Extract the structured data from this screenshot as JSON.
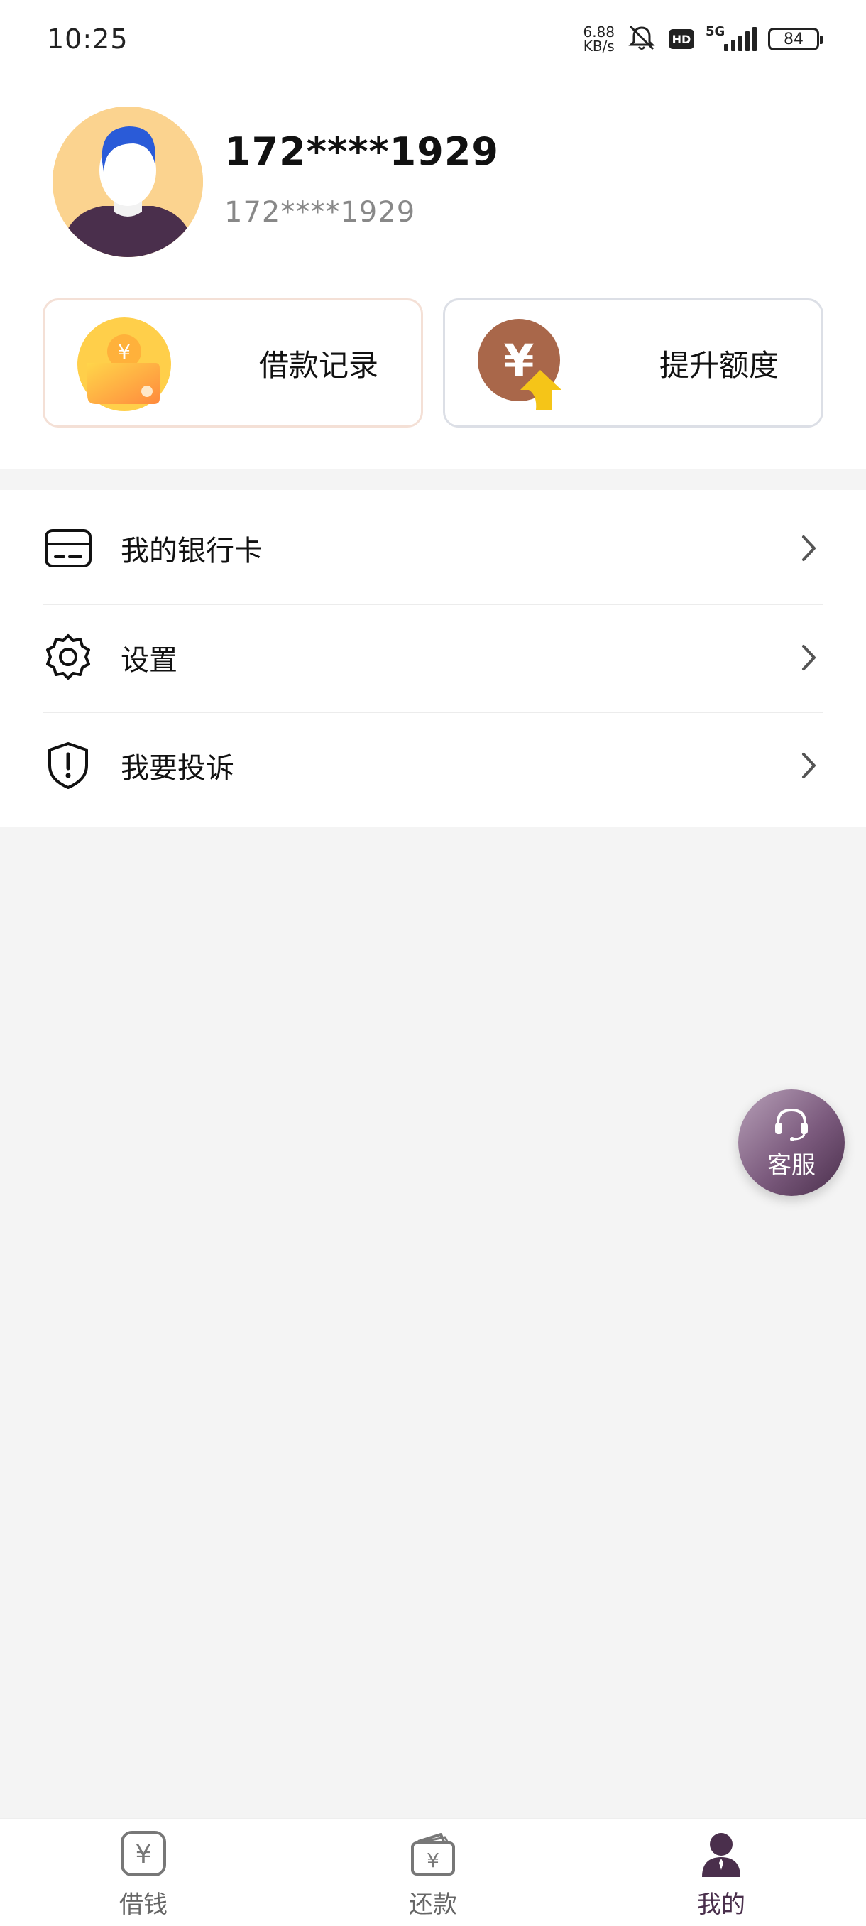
{
  "status_bar": {
    "time": "10:25",
    "net_speed_value": "6.88",
    "net_speed_unit": "KB/s",
    "hd_label": "HD",
    "network_type": "5G",
    "battery_level": "84"
  },
  "profile": {
    "name": "172****1929",
    "subtitle": "172****1929"
  },
  "cards": {
    "loan_records": "借款记录",
    "raise_limit": "提升额度"
  },
  "menu": {
    "items": [
      {
        "label": "我的银行卡",
        "icon": "bank-card-icon"
      },
      {
        "label": "设置",
        "icon": "settings-gear-icon"
      },
      {
        "label": "我要投诉",
        "icon": "shield-alert-icon"
      }
    ]
  },
  "service_button": {
    "label": "客服",
    "icon": "headset-icon"
  },
  "tabbar": {
    "tabs": [
      {
        "label": "借钱",
        "icon": "yuan-coin-icon",
        "active": false
      },
      {
        "label": "还款",
        "icon": "wallet-yuan-icon",
        "active": false
      },
      {
        "label": "我的",
        "icon": "person-icon",
        "active": true
      }
    ]
  },
  "colors": {
    "accent": "#4a2f4c",
    "service_gradient_start": "#b7a0b8",
    "service_gradient_end": "#4a2f4c",
    "avatar_bg": "#fbd38f",
    "page_bg": "#f4f4f4"
  }
}
